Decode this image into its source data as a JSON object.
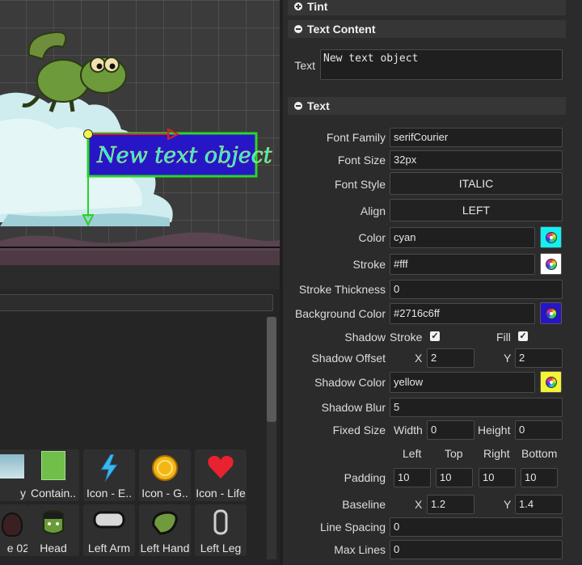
{
  "scene": {
    "text_object": "New text object",
    "colors": {
      "fill": "cyan",
      "stroke": "#fff",
      "background": "#2716c6",
      "shadow": "yellow"
    }
  },
  "assets": {
    "tiles": [
      {
        "label": "y",
        "icon": "sky-image"
      },
      {
        "label": "Contain..",
        "icon": "container-image"
      },
      {
        "label": "Icon - E..",
        "icon": "lightning-icon"
      },
      {
        "label": "Icon - G..",
        "icon": "gold-coin-icon"
      },
      {
        "label": "Icon - Life",
        "icon": "heart-icon"
      },
      {
        "label": "e 02",
        "icon": "monster-image"
      },
      {
        "label": "Head",
        "icon": "head-image"
      },
      {
        "label": "Left Arm",
        "icon": "arm-image"
      },
      {
        "label": "Left Hand",
        "icon": "hand-image"
      },
      {
        "label": "Left Leg",
        "icon": "leg-image"
      }
    ]
  },
  "panel": {
    "tint_header": "Tint",
    "text_content_header": "Text Content",
    "text_label": "Text",
    "text_value": "New text object",
    "text_header": "Text",
    "font_family_label": "Font Family",
    "font_family": "serifCourier",
    "font_size_label": "Font Size",
    "font_size": "32px",
    "font_style_label": "Font Style",
    "font_style": "ITALIC",
    "align_label": "Align",
    "align": "LEFT",
    "color_label": "Color",
    "color": "cyan",
    "stroke_label": "Stroke",
    "stroke": "#fff",
    "stroke_thickness_label": "Stroke Thickness",
    "stroke_thickness": "0",
    "bg_color_label": "Background Color",
    "bg_color": "#2716c6ff",
    "shadow_label": "Shadow",
    "shadow_stroke_label": "Stroke",
    "shadow_stroke_checked": true,
    "shadow_fill_label": "Fill",
    "shadow_fill_checked": true,
    "shadow_offset_label": "Shadow Offset",
    "x_label": "X",
    "y_label": "Y",
    "shadow_offset_x": "2",
    "shadow_offset_y": "2",
    "shadow_color_label": "Shadow Color",
    "shadow_color": "yellow",
    "shadow_blur_label": "Shadow Blur",
    "shadow_blur": "5",
    "fixed_size_label": "Fixed Size",
    "width_label": "Width",
    "width": "0",
    "height_label": "Height",
    "height": "0",
    "padding_cols": [
      "Left",
      "Top",
      "Right",
      "Bottom"
    ],
    "padding_label": "Padding",
    "padding": [
      "10",
      "10",
      "10",
      "10"
    ],
    "baseline_label": "Baseline",
    "baseline_x": "1.2",
    "baseline_y": "1.4",
    "line_spacing_label": "Line Spacing",
    "line_spacing": "0",
    "max_lines_label": "Max Lines",
    "max_lines": "0",
    "swatch_colors": {
      "color": "#12f0f4",
      "stroke": "#ffffff",
      "bg": "#2716c6",
      "shadow": "#f4f436"
    }
  }
}
